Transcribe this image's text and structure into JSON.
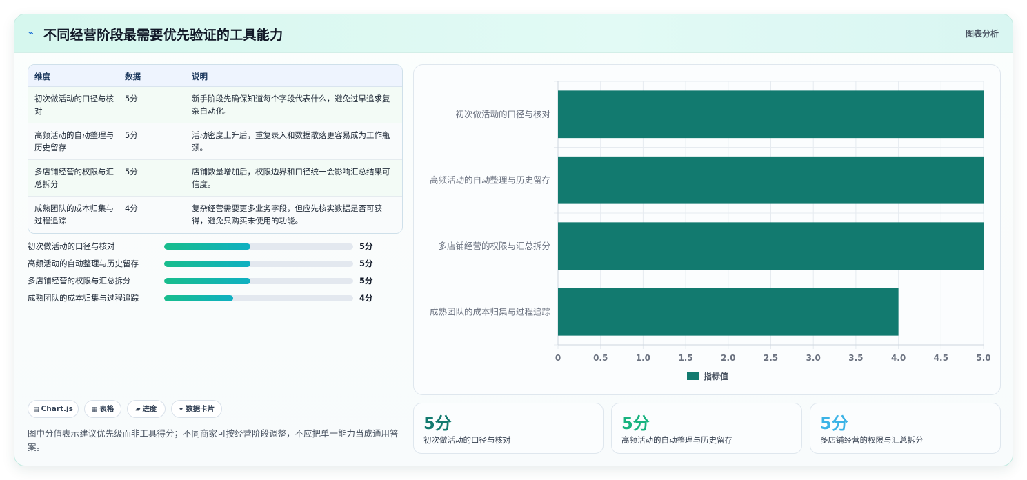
{
  "header": {
    "title": "不同经营阶段最需要优先验证的工具能力",
    "tag": "图表分析",
    "spark_icon": "sparkle-icon"
  },
  "table": {
    "columns": [
      "维度",
      "数据",
      "说明"
    ],
    "rows": [
      {
        "dim": "初次做活动的口径与核对",
        "value": "5分",
        "desc": "新手阶段先确保知道每个字段代表什么，避免过早追求复杂自动化。"
      },
      {
        "dim": "高频活动的自动整理与历史留存",
        "value": "5分",
        "desc": "活动密度上升后，重复录入和数据散落更容易成为工作瓶颈。"
      },
      {
        "dim": "多店铺经营的权限与汇总拆分",
        "value": "5分",
        "desc": "店铺数量增加后，权限边界和口径统一会影响汇总结果可信度。"
      },
      {
        "dim": "成熟团队的成本归集与过程追踪",
        "value": "4分",
        "desc": "复杂经营需要更多业务字段，但应先核实数据是否可获得，避免只购买未使用的功能。"
      }
    ]
  },
  "progress": [
    {
      "label": "初次做活动的口径与核对",
      "value": "5分",
      "fraction": 0.4545
    },
    {
      "label": "高频活动的自动整理与历史留存",
      "value": "5分",
      "fraction": 0.4545
    },
    {
      "label": "多店铺经营的权限与汇总拆分",
      "value": "5分",
      "fraction": 0.4545
    },
    {
      "label": "成熟团队的成本归集与过程追踪",
      "value": "4分",
      "fraction": 0.3636
    }
  ],
  "chips": [
    {
      "icon": "▤",
      "label": "Chart.js"
    },
    {
      "icon": "▦",
      "label": "表格"
    },
    {
      "icon": "▰",
      "label": "进度"
    },
    {
      "icon": "✦",
      "label": "数据卡片"
    }
  ],
  "note": "图中分值表示建议优先级而非工具得分；不同商家可按经营阶段调整，不应把单一能力当成通用答案。",
  "chart_data": {
    "type": "bar",
    "orientation": "horizontal",
    "categories": [
      "初次做活动的口径与核对",
      "高频活动的自动整理与历史留存",
      "多店铺经营的权限与汇总拆分",
      "成熟团队的成本归集与过程追踪"
    ],
    "series": [
      {
        "name": "指标值",
        "values": [
          5,
          5,
          5,
          4
        ],
        "color": "#127a6f"
      }
    ],
    "xlim": [
      0,
      5
    ],
    "ticks": [
      "0",
      "0.5",
      "1.0",
      "1.5",
      "2.0",
      "2.5",
      "3.0",
      "3.5",
      "4.0",
      "4.5",
      "5.0"
    ],
    "tick_values": [
      0,
      0.5,
      1,
      1.5,
      2,
      2.5,
      3,
      3.5,
      4,
      4.5,
      5
    ],
    "grid": true,
    "legend": "bottom"
  },
  "stats": [
    {
      "value": "5分",
      "label": "初次做活动的口径与核对",
      "color": "#127a6f"
    },
    {
      "value": "5分",
      "label": "高频活动的自动整理与历史留存",
      "color": "#18b37f"
    },
    {
      "value": "5分",
      "label": "多店铺经营的权限与汇总拆分",
      "color": "#3bb3e6"
    }
  ]
}
